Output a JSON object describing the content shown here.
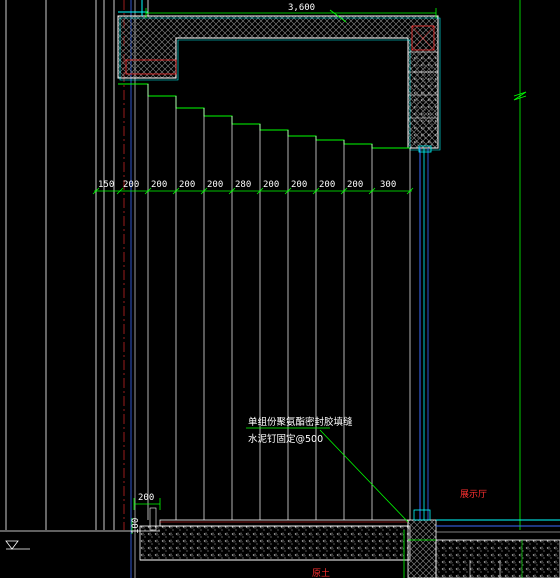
{
  "drawing": {
    "top_dimension": "3,600",
    "height_dim_left": "100",
    "step_dim": "200",
    "spacing_dims": [
      "150",
      "200",
      "200",
      "200",
      "200",
      "280",
      "200",
      "200",
      "200",
      "200",
      "300"
    ],
    "note_line1": "单组份聚氨酯密封胶填缝",
    "note_line2": "水泥钉固定@500",
    "room_label": "展示厅",
    "bottom_label": "原土"
  },
  "colors": {
    "background": "#000000",
    "line_white": "#ffffff",
    "line_green": "#00ff00",
    "line_cyan": "#00ffff",
    "line_blue": "#3b6cff",
    "line_red": "#ff3030",
    "hatch_gray": "#9a9a9a"
  }
}
